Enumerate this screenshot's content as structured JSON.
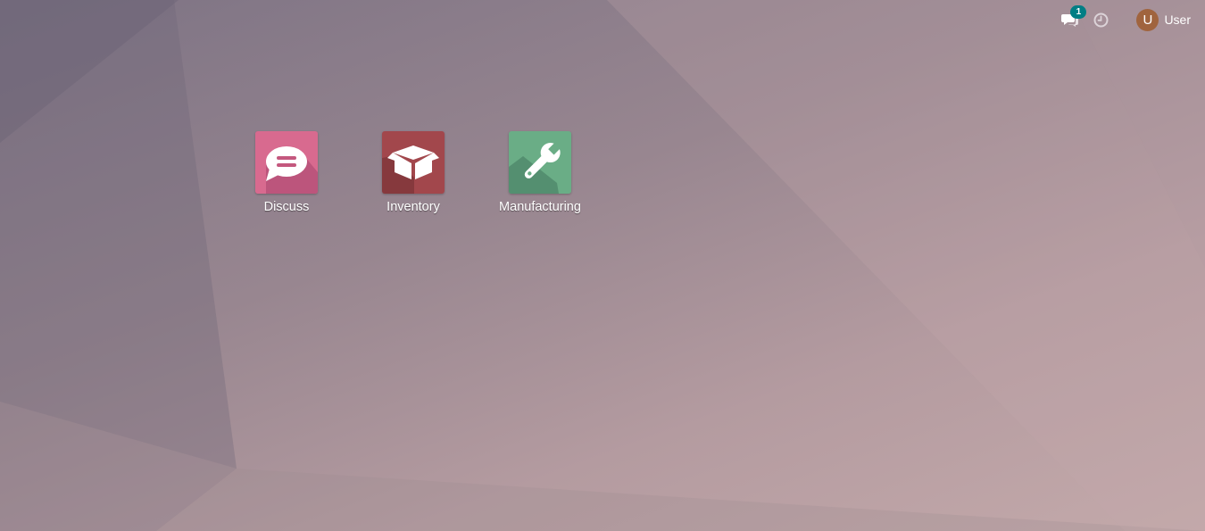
{
  "systray": {
    "messaging": {
      "icon": "chat-bubbles-icon",
      "unread_count": "1",
      "badge_color": "#017e84"
    },
    "activity": {
      "icon": "clock-icon"
    },
    "user": {
      "avatar_initial": "U",
      "name": "User",
      "avatar_color": "#a0643e"
    }
  },
  "apps": [
    {
      "label": "Discuss",
      "icon": "speech-bubble-icon",
      "color": "#c4587e"
    },
    {
      "label": "Inventory",
      "icon": "box-icon",
      "color": "#9b4246"
    },
    {
      "label": "Manufacturing",
      "icon": "wrench-icon",
      "color": "#6aad86"
    }
  ]
}
